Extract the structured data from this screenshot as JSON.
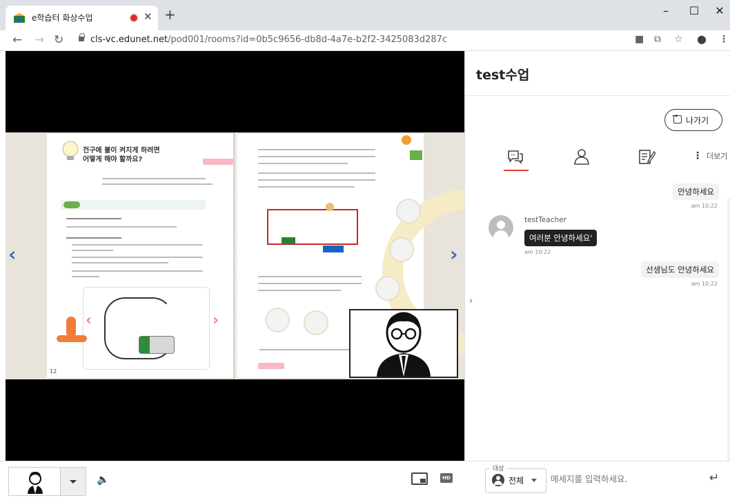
{
  "browser": {
    "tab_title": "e학습터 화상수업",
    "url_domain": "cls-vc.edunet.net",
    "url_path": "/pod001/rooms?id=0b5c9656-db8d-4a7e-b2f2-3425083d287c"
  },
  "slide": {
    "chapter_title_line1": "전구에 불이 켜지게 하려면",
    "chapter_title_line2": "어떻게 해야 할까요?",
    "page_number": "12"
  },
  "chat": {
    "room_title": "test수업",
    "leave_label": "나가기",
    "more_label": "더보기",
    "messages": [
      {
        "text": "안녕하세요",
        "time": "am 10:22"
      },
      {
        "sender": "testTeacher",
        "text": "여러분 안녕하세요'",
        "time": "am 10:22"
      },
      {
        "text": "선생님도 안녕하세요",
        "time": "am 10:22"
      }
    ]
  },
  "bottom": {
    "target_label": "대상",
    "target_value": "전체",
    "input_placeholder": "메세지를 입력하세요.",
    "hd_label": "HD"
  },
  "colors": {
    "accent_red": "#e53935",
    "chrome_bg": "#dee1e6"
  }
}
